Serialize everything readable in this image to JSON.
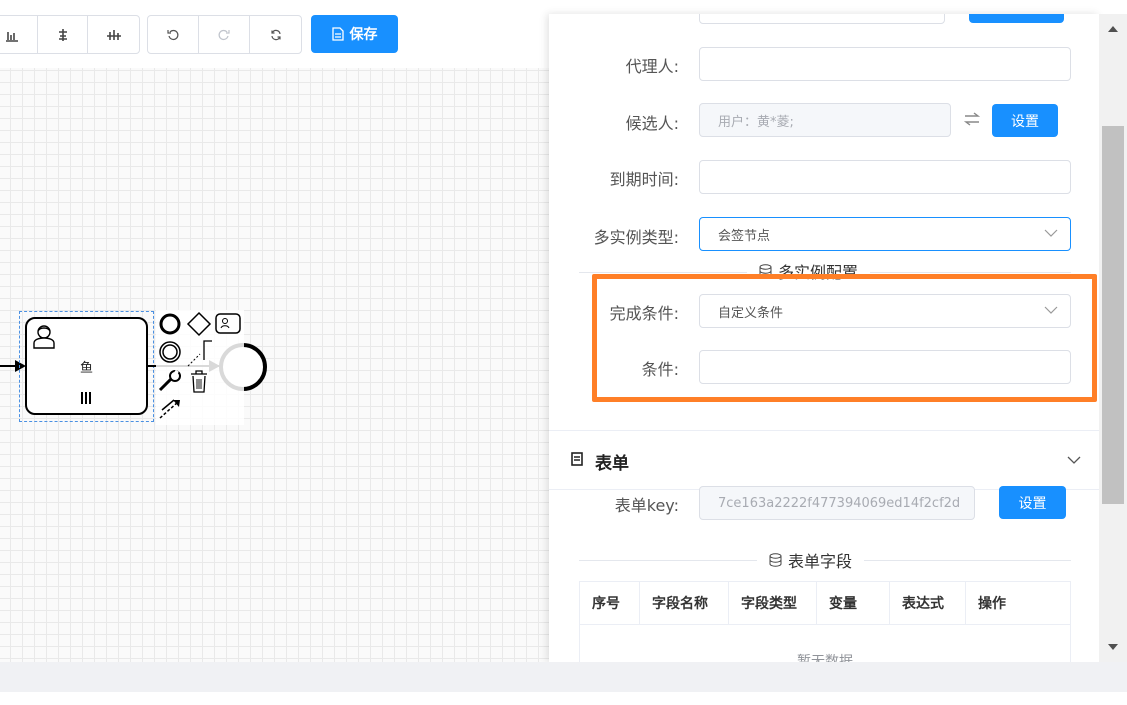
{
  "toolbar": {
    "align_icons": [
      "align-bottom-icon",
      "align-center-icon",
      "align-middle-icon"
    ],
    "history_icons": [
      "undo-icon",
      "redo-icon",
      "refresh-icon"
    ],
    "save_label": "保存"
  },
  "diagram": {
    "task_label": "鱼"
  },
  "form": {
    "agent_label": "代理人:",
    "candidate_label": "候选人:",
    "candidate_value": "用户：黄*菱;",
    "candidate_set_btn": "设置",
    "due_label": "到期时间:",
    "multi_type_label": "多实例类型:",
    "multi_type_value": "会签节点",
    "multi_config_title": "多实例配置",
    "complete_cond_label": "完成条件:",
    "complete_cond_value": "自定义条件",
    "condition_label": "条件:"
  },
  "form_section": {
    "title": "表单",
    "key_label": "表单key:",
    "key_value": "7ce163a2222f477394069ed14f2cf2d",
    "key_set_btn": "设置",
    "fields_title": "表单字段",
    "columns": [
      "序号",
      "字段名称",
      "字段类型",
      "变量",
      "表达式",
      "操作"
    ],
    "empty_text": "暂无数据"
  },
  "colors": {
    "accent": "#1890ff",
    "highlight": "#ff7f27"
  }
}
